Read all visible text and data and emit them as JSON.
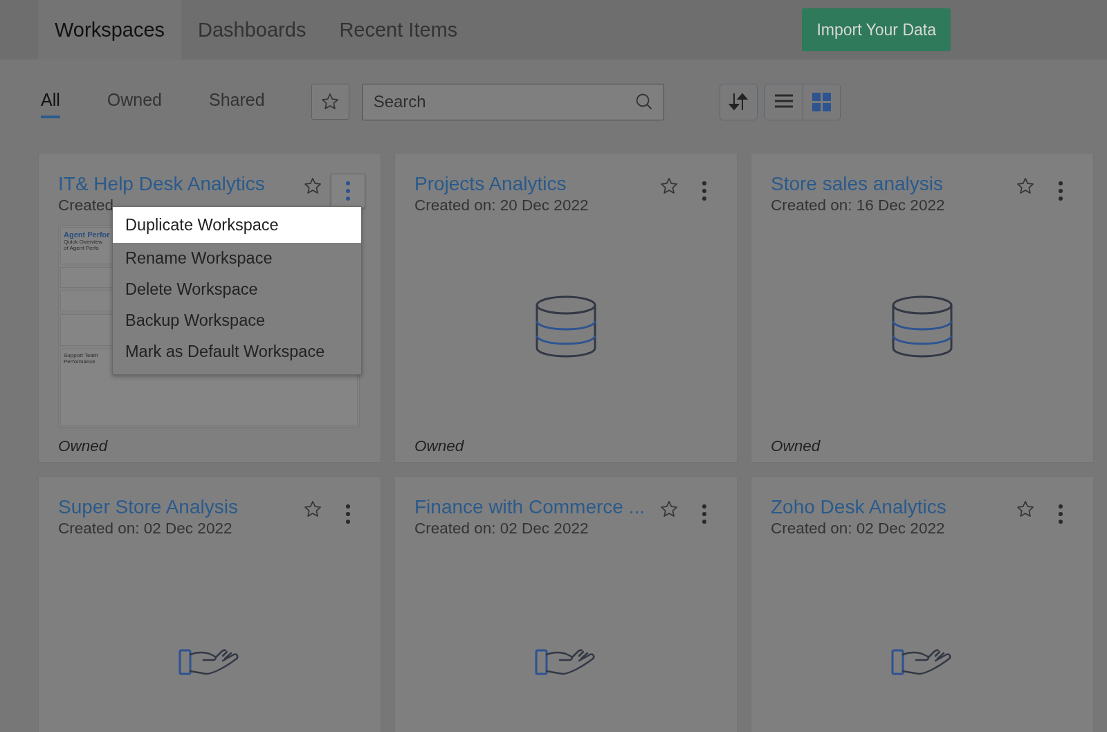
{
  "tabs": [
    {
      "label": "Workspaces",
      "selected": true
    },
    {
      "label": "Dashboards",
      "selected": false
    },
    {
      "label": "Recent Items",
      "selected": false
    }
  ],
  "import_button": "Import Your Data",
  "filters": [
    {
      "label": "All",
      "selected": true
    },
    {
      "label": "Owned",
      "selected": false
    },
    {
      "label": "Shared",
      "selected": false
    }
  ],
  "search": {
    "placeholder": "Search"
  },
  "view_modes": [
    {
      "kind": "list",
      "selected": false
    },
    {
      "kind": "grid",
      "selected": true
    }
  ],
  "cards": [
    {
      "title": "IT& Help Desk Analytics",
      "created": "Created",
      "kind": "preview",
      "preview": {
        "heading": "Agent Perfor",
        "subheading": "Quick Overview of Agent Perfo",
        "section": "Support Team Performance"
      },
      "footer": "Owned",
      "menu_open": true
    },
    {
      "title": "Projects Analytics",
      "created": "Created on: 20 Dec 2022",
      "kind": "database",
      "footer": "Owned",
      "menu_open": false
    },
    {
      "title": "Store sales analysis",
      "created": "Created on: 16 Dec 2022",
      "kind": "database",
      "footer": "Owned",
      "menu_open": false
    },
    {
      "title": "Super Store Analysis",
      "created": "Created on: 02 Dec 2022",
      "kind": "hand",
      "menu_open": false
    },
    {
      "title": "Finance with Commerce ...",
      "created": "Created on: 02 Dec 2022",
      "kind": "hand",
      "menu_open": false
    },
    {
      "title": "Zoho Desk Analytics",
      "created": "Created on: 02 Dec 2022",
      "kind": "hand",
      "menu_open": false
    }
  ],
  "context_menu": [
    {
      "label": "Duplicate Workspace",
      "selected": true
    },
    {
      "label": "Rename Workspace",
      "selected": false
    },
    {
      "label": "Delete Workspace",
      "selected": false
    },
    {
      "label": "Backup Workspace",
      "selected": false
    },
    {
      "label": "Mark as Default Workspace",
      "selected": false
    }
  ]
}
